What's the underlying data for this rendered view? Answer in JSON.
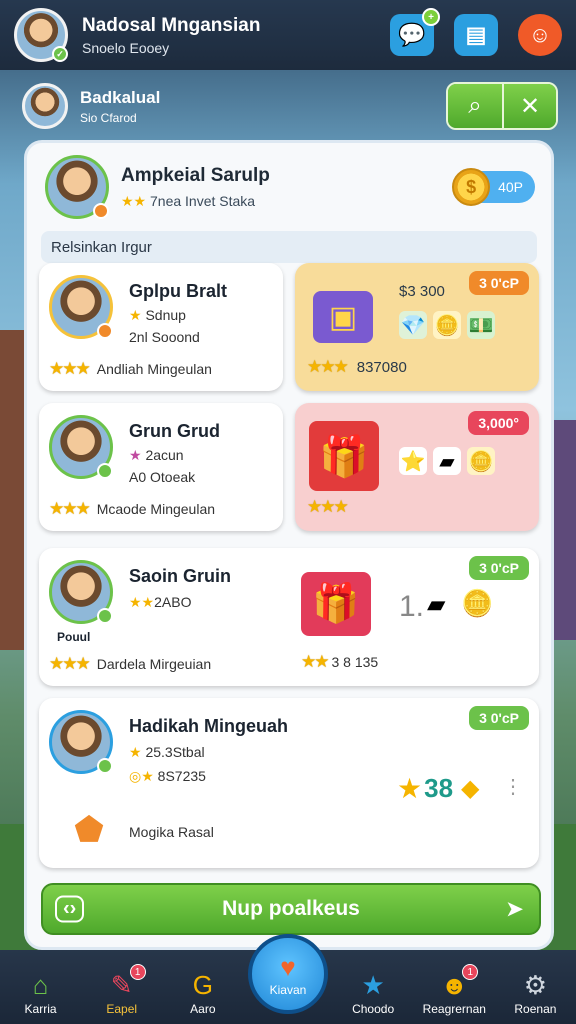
{
  "topbar": {
    "title": "Nadosal Mngansian",
    "subtitle": "Snoelo Eooey",
    "badge": "✓",
    "buttons": [
      {
        "name": "chat",
        "icon": "chat-bubble-icon",
        "badge": "+"
      },
      {
        "name": "news",
        "icon": "newspaper-icon"
      },
      {
        "name": "game",
        "icon": "gamepad-icon"
      }
    ]
  },
  "subhead": {
    "title": "Badkalual",
    "subtitle": "Sio Cfarod"
  },
  "panel": {
    "profile_name": "Ampkeial Sarulp",
    "profile_sub": "7nea Invet Staka",
    "coin_value": "40P",
    "coin_symbol": "$",
    "section_label": "Relsinkan Irgur"
  },
  "cards": [
    {
      "title": "Gplpu Bralt",
      "line1": "Sdnup",
      "line2": "2nl Sooond",
      "footer": "Andliah Mingeulan",
      "badge": "P",
      "right_tag": "3 0'cP",
      "right_amount": "$3 300",
      "right_footer": "837080"
    },
    {
      "title": "Grun Grud",
      "line1": "2acun",
      "line2": "A0 Otoeak",
      "footer": "Mcaode Mingeulan",
      "right_tag": "3,000°"
    },
    {
      "title": "Saoin Gruin",
      "line1": "2ABO",
      "footer": "Dardela Mirgeuian",
      "avatar_label": "Pouul",
      "right_tag": "3 0'cP",
      "right_value": "1.",
      "right_footer": "3 8 135"
    },
    {
      "title": "Hadikah Mingeuah",
      "line1": "25.3Stbal",
      "line2": "8S7235",
      "footer": "Mogika Rasal",
      "right_tag": "3 0'cP",
      "right_value": "38"
    }
  ],
  "cta": {
    "label": "Nup poalkeus"
  },
  "nav": [
    {
      "label": "Karria",
      "icon": "home-icon"
    },
    {
      "label": "Eapel",
      "icon": "wand-icon",
      "badge": "1"
    },
    {
      "label": "Aaro",
      "icon": "gauge-icon"
    },
    {
      "label": "Kiavan",
      "icon": "heart-icon"
    },
    {
      "label": "Choodo",
      "icon": "star-icon"
    },
    {
      "label": "Reagrernan",
      "icon": "face-icon",
      "badge": "1"
    },
    {
      "label": "Roenan",
      "icon": "settings-icon"
    }
  ],
  "colors": {
    "accent_green": "#6cc24a",
    "accent_blue": "#2b9fe0",
    "tag_orange": "#f08a2a",
    "tag_red": "#e8465c"
  }
}
